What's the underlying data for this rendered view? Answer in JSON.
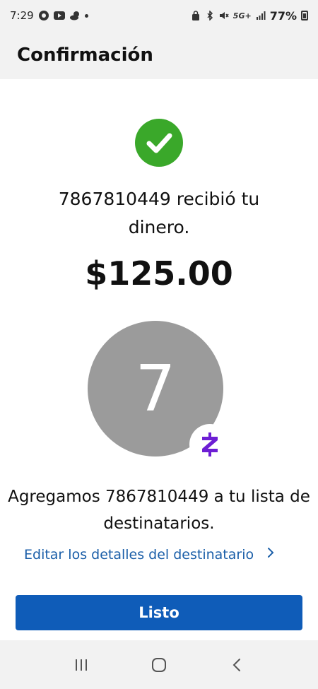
{
  "status_bar": {
    "time": "7:29",
    "network": "5G+",
    "battery": "77%"
  },
  "header": {
    "title": "Confirmación"
  },
  "confirmation": {
    "message": "7867810449 recibió tu dinero.",
    "amount": "$125.00",
    "avatar_initial": "7",
    "added_message": "Agregamos 7867810449 a tu lista de destinatarios.",
    "edit_link": "Editar los detalles del destinatario",
    "done_label": "Listo"
  },
  "colors": {
    "accent": "#0f5cb8",
    "link": "#1a5ea8",
    "success": "#3aa82a",
    "zelle": "#6d1ed4",
    "avatar": "#9b9b9b"
  },
  "icons": {
    "success": "checkmark-icon",
    "brand": "zelle-icon",
    "edit_chevron": "chevron-right-icon",
    "nav_recents": "recents-icon",
    "nav_home": "home-icon",
    "nav_back": "back-icon"
  }
}
